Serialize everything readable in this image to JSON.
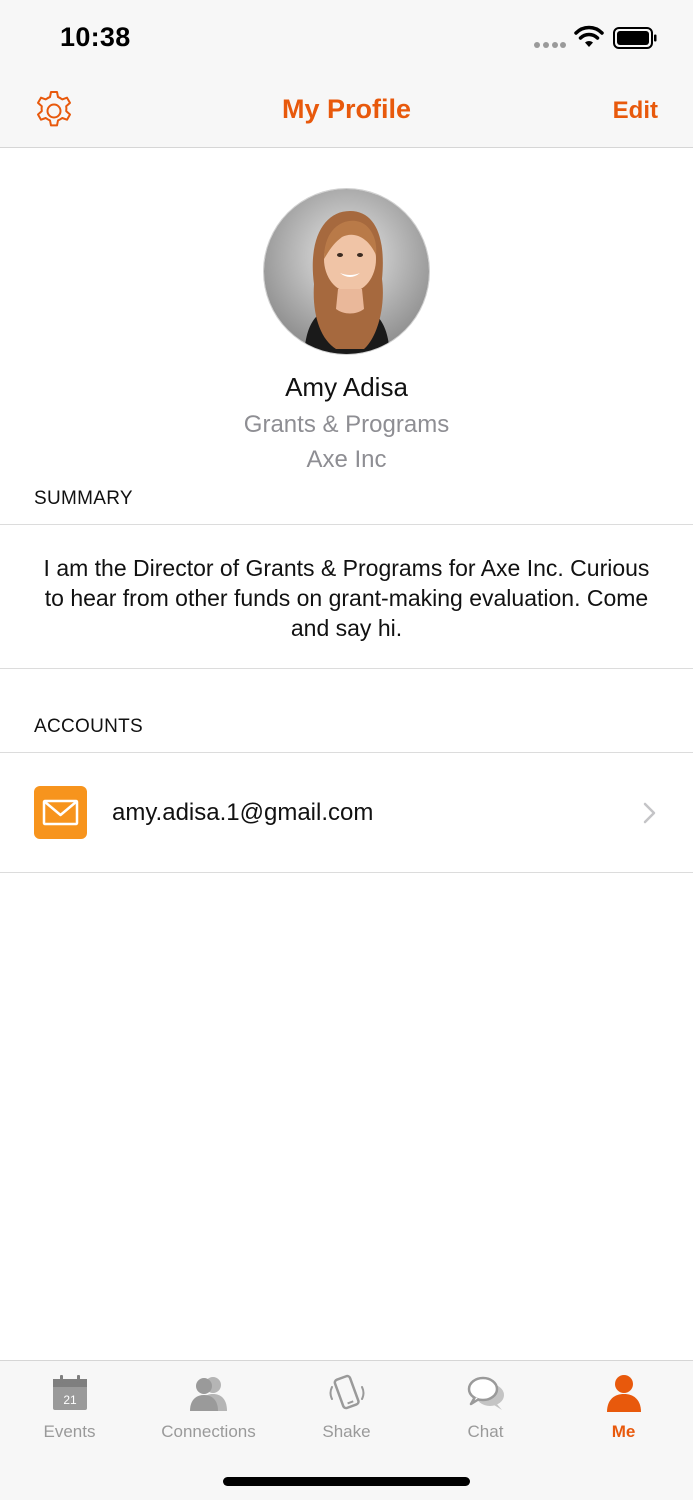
{
  "status_bar": {
    "time": "10:38"
  },
  "nav": {
    "title": "My Profile",
    "edit_label": "Edit",
    "accent_color": "#e8590c",
    "left_icon": "gear-icon"
  },
  "profile": {
    "name": "Amy Adisa",
    "title": "Grants & Programs",
    "company": "Axe Inc"
  },
  "summary": {
    "header": "SUMMARY",
    "text": "I am the Director of Grants & Programs for Axe Inc. Curious to hear from other funds on grant-making evaluation. Come and say hi."
  },
  "accounts": {
    "header": "ACCOUNTS",
    "items": [
      {
        "icon": "mail-icon",
        "label": "amy.adisa.1@gmail.com",
        "icon_color": "#f7941d"
      }
    ]
  },
  "tabs": [
    {
      "label": "Events",
      "icon": "calendar-icon",
      "calendar_day": "21",
      "active": false
    },
    {
      "label": "Connections",
      "icon": "people-icon",
      "active": false
    },
    {
      "label": "Shake",
      "icon": "phone-shake-icon",
      "active": false
    },
    {
      "label": "Chat",
      "icon": "chat-bubbles-icon",
      "active": false
    },
    {
      "label": "Me",
      "icon": "person-icon",
      "active": true
    }
  ]
}
